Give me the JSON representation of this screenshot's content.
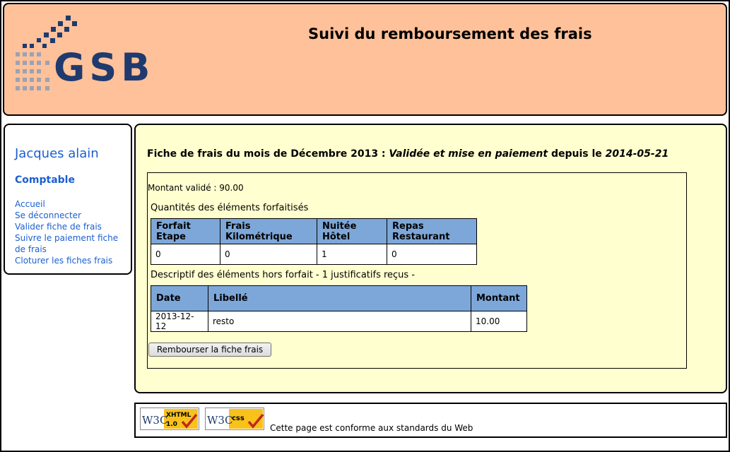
{
  "header": {
    "logo_text": "GSB",
    "title": "Suivi du remboursement des frais"
  },
  "sidebar": {
    "user_name": "Jacques alain",
    "role": "Comptable",
    "menu": [
      {
        "label": "Accueil"
      },
      {
        "label": "Se déconnecter"
      },
      {
        "label": "Valider fiche de frais"
      },
      {
        "label": "Suivre le paiement fiche de frais"
      },
      {
        "label": "Cloturer les fiches frais"
      }
    ]
  },
  "fiche": {
    "title_prefix": "Fiche de frais du mois de Décembre 2013 : ",
    "etat": "Validée et mise en paiement",
    "depuis_label": " depuis le ",
    "date_modif": "2014-05-21",
    "montant_valide": "Montant validé : 90.00",
    "forfait_caption": "Quantités des éléments forfaitisés",
    "forfait_headers": [
      "Forfait Etape",
      "Frais Kilométrique",
      "Nuitée Hôtel",
      "Repas Restaurant"
    ],
    "forfait_values": [
      "0",
      "0",
      "1",
      "0"
    ],
    "hors_forfait_caption": "Descriptif des éléments hors forfait - 1 justificatifs reçus -",
    "hors_forfait_headers": [
      "Date",
      "Libellé",
      "Montant"
    ],
    "hors_forfait_rows": [
      [
        "2013-12-12",
        "resto",
        "10.00"
      ]
    ],
    "button_label": "Rembourser la fiche frais"
  },
  "footer": {
    "badge_xhtml": {
      "w3c": "W3C",
      "label": "XHTML",
      "version": "1.0"
    },
    "badge_css": {
      "w3c": "W3C",
      "label": "css"
    },
    "text": "Cette page est conforme aux standards du Web"
  },
  "colors": {
    "header_bg": "#ffc199",
    "content_bg": "#ffffcf",
    "table_header_bg": "#7da7d9",
    "link": "#1a5fd0",
    "logo": "#1f3a6e"
  }
}
